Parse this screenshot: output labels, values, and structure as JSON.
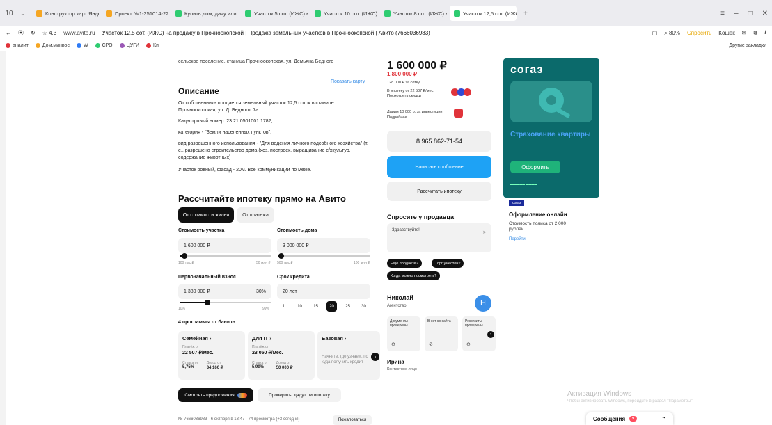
{
  "browser": {
    "tabs": [
      {
        "label": "Конструктор карт Яндекс",
        "color": "#f5a623"
      },
      {
        "label": "Проект №1-251014-2297",
        "color": "#f5a623"
      },
      {
        "label": "Купить дом, дачу или коттедж",
        "color": "#2ecc71"
      },
      {
        "label": "Участок 5 сот. (ИЖС) на продажу",
        "color": "#2ecc71"
      },
      {
        "label": "Участок 10 сот. (ИЖС) на продажу",
        "color": "#2ecc71"
      },
      {
        "label": "Участок 8 сот. (ИЖС) на продажу",
        "color": "#2ecc71"
      },
      {
        "label": "Участок 12,5 сот. (ИЖС)",
        "color": "#2ecc71",
        "active": true
      }
    ],
    "rating": "4,3",
    "url": "www.avito.ru",
    "page_title": "Участок 12,5 сот. (ИЖС) на продажу в Прочноокопской | Продажа земельных участков в Прочноокопской | Авито (7666036983)",
    "zoom": "80%",
    "ask_label": "Спросить",
    "wallet_label": "Кошёк",
    "bookmarks": [
      "аналит",
      "Дом.минвос",
      "W",
      "СРО",
      "ЦУГИ",
      "Кп"
    ],
    "other_bookmarks": "Другие закладки"
  },
  "listing": {
    "location": "сельское поселение, станица Прочноокопская, ул. Демьяна Бедного",
    "map_link": "Показать карту",
    "description_title": "Описание",
    "description": [
      "От собственника продается земельный участок 12,5 соток в станице Прочноокопская, ул. Д. Бедного, 7а.",
      "Кадастровый номер: 23:21:0501001:1782;",
      "категория - \"Земли населенных пунктов\";",
      "вид разрешенного использования - \"Для ведения личного подсобного хозяйства\" (т. е., разрешено строительство дома (хоз. построек, выращивание с/хкультур, содержание животных)",
      "Участок ровный, фасад - 20м. Все коммуникации по меже."
    ],
    "footer_meta": "№ 7666036983 · 6 октября в 13:47 · 74 просмотра (+3 сегодня)",
    "complain": "Пожаловаться"
  },
  "mortgage": {
    "title": "Рассчитайте ипотеку прямо на Авито",
    "seg_by_cost": "От стоимости жилья",
    "seg_by_payment": "От платежа",
    "plot_cost_label": "Стоимость участка",
    "plot_cost_value": "1 600 000 ₽",
    "plot_min": "100 тыс.₽",
    "plot_max": "50 млн ₽",
    "plot_fill": 0.05,
    "house_cost_label": "Стоимость дома",
    "house_cost_value": "3 000 000 ₽",
    "house_min": "500 тыс.₽",
    "house_max": "100 млн ₽",
    "house_fill": 0.03,
    "down_label": "Первоначальный взнос",
    "down_value": "1 380 000 ₽",
    "down_pct": "30%",
    "down_min": "10%",
    "down_max": "99%",
    "down_fill": 0.3,
    "term_label": "Срок кредита",
    "term_value": "20 лет",
    "term_options": [
      "1",
      "10",
      "15",
      "20",
      "25",
      "30"
    ],
    "term_selected": 3,
    "programs_title": "4 программы от банков",
    "programs": [
      {
        "title": "Семейная ›",
        "sub": "Платёж от",
        "value": "22 507 ₽/мес.",
        "rate_lbl": "Ставка от",
        "rate": "5,75%",
        "income_lbl": "Доход от",
        "income": "34 160 ₽"
      },
      {
        "title": "Для IT ›",
        "sub": "Платёж от",
        "value": "23 050 ₽/мес.",
        "rate_lbl": "Ставка от",
        "rate": "5,99%",
        "income_lbl": "Доход от",
        "income": "50 000 ₽"
      },
      {
        "title": "Базовая ›",
        "note": "Начните, где узнаем, по куда получить кредит"
      }
    ],
    "offers_btn": "Смотреть предложения",
    "check_btn": "Проверить, дадут ли ипотеку"
  },
  "seller": {
    "price": "1 600 000 ₽",
    "old_price": "1 800 000 ₽",
    "per_sotka": "128 000 ₽ за сотку",
    "installment": "В ипотеку от 22 507 ₽/мес.",
    "installment_link": "Посмотреть скидки",
    "bonus_line": "Дарим 10 000 р. за инвестиции",
    "bonus_link": "Подробнее",
    "phone": "8 965 862-71-54",
    "message_btn": "Написать сообщение",
    "calc_btn": "Рассчитать ипотеку",
    "ask_title": "Спросите у продавца",
    "ask_value": "Здравствуйте!",
    "quick_questions": [
      "Ещё продаёте?",
      "Торг уместен?",
      "Когда можно посмотреть?"
    ],
    "name": "Николай",
    "type": "Агентство",
    "avatar_letter": "Н",
    "cards": [
      "Документы проверены",
      "В нет со сайта",
      "Реквизиты проверены"
    ],
    "contact_name": "Ирина",
    "contact_type": "Контактное лицо"
  },
  "ad": {
    "brand": "согаз",
    "headline": "Страхование квартиры",
    "button": "Оформить",
    "mark": "согаз",
    "title": "Оформление онлайн",
    "subtitle": "Стоимость полиса от 2 000 рублей",
    "go": "Перейти",
    "bg": "#0b6a6b",
    "accent": "#1fb37a"
  },
  "system": {
    "activation_title": "Активация Windows",
    "activation_sub": "Чтобы активировать Windows, перейдите в раздел \"Параметры\".",
    "messages_label": "Сообщения",
    "messages_count": "9"
  }
}
